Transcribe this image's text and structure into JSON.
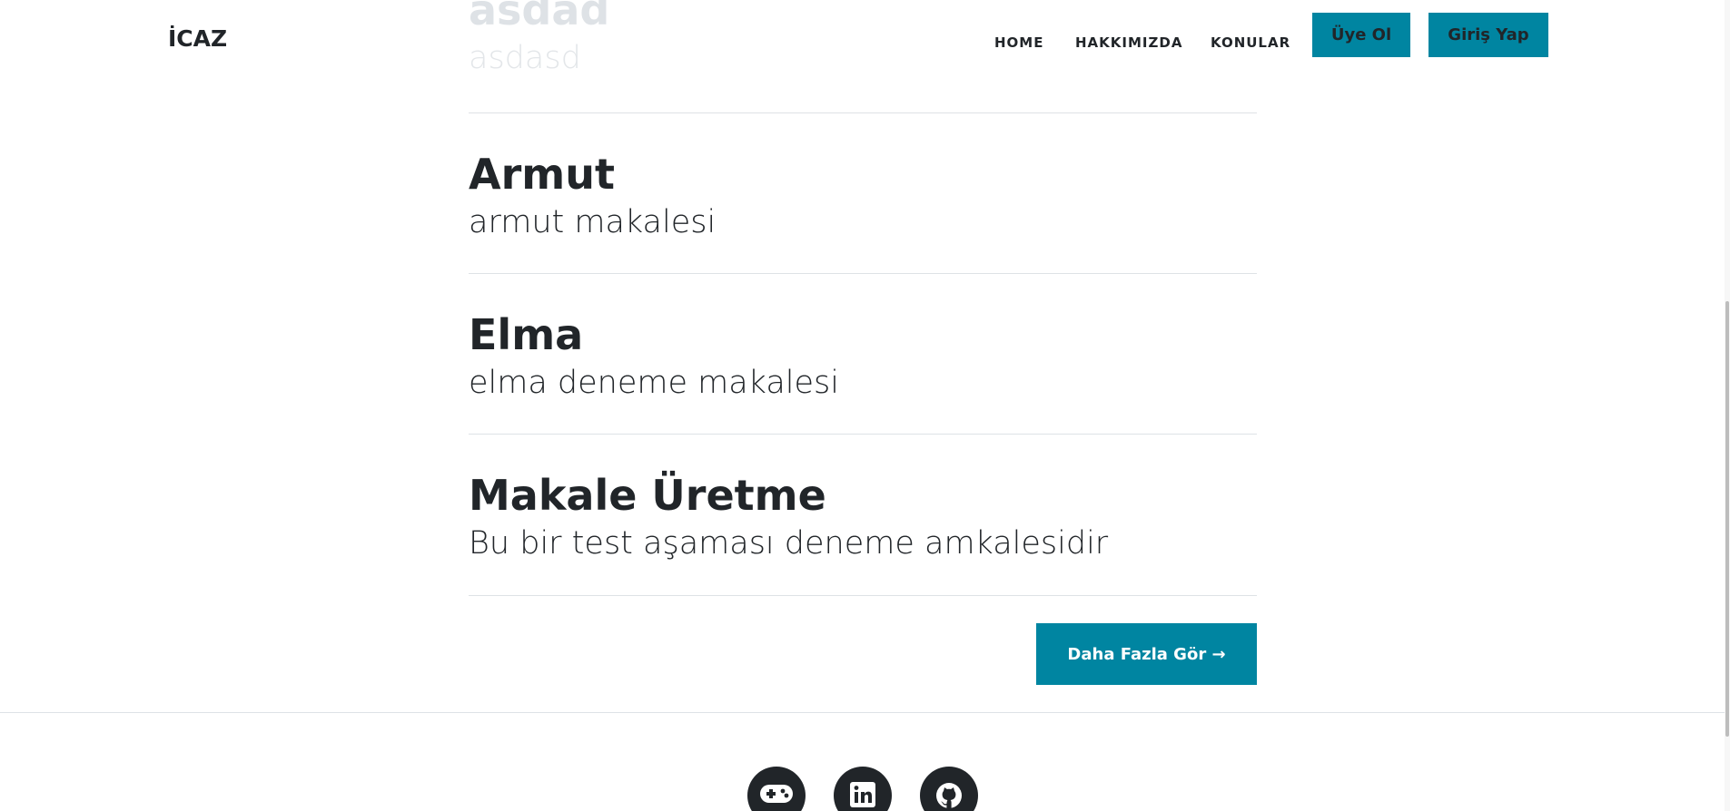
{
  "navbar": {
    "brand": "İCAZ",
    "links": [
      "HOME",
      "HAKKIMIZDA",
      "KONULAR"
    ],
    "register_label": "Üye Ol",
    "login_label": "Giriş Yap"
  },
  "posts": [
    {
      "title": "asdad",
      "subtitle": "asdasd"
    },
    {
      "title": "Armut",
      "subtitle": "armut makalesi"
    },
    {
      "title": "Elma",
      "subtitle": "elma deneme makalesi"
    },
    {
      "title": "Makale Üretme",
      "subtitle": "Bu bir test aşaması deneme amkalesidir"
    }
  ],
  "more_button_label": "Daha Fazla Gör →",
  "footer": {
    "social_icons": [
      "gamepad-icon",
      "linkedin-icon",
      "github-icon"
    ]
  },
  "colors": {
    "accent": "#0085a1",
    "text": "#212529",
    "divider": "#dee2e6"
  }
}
